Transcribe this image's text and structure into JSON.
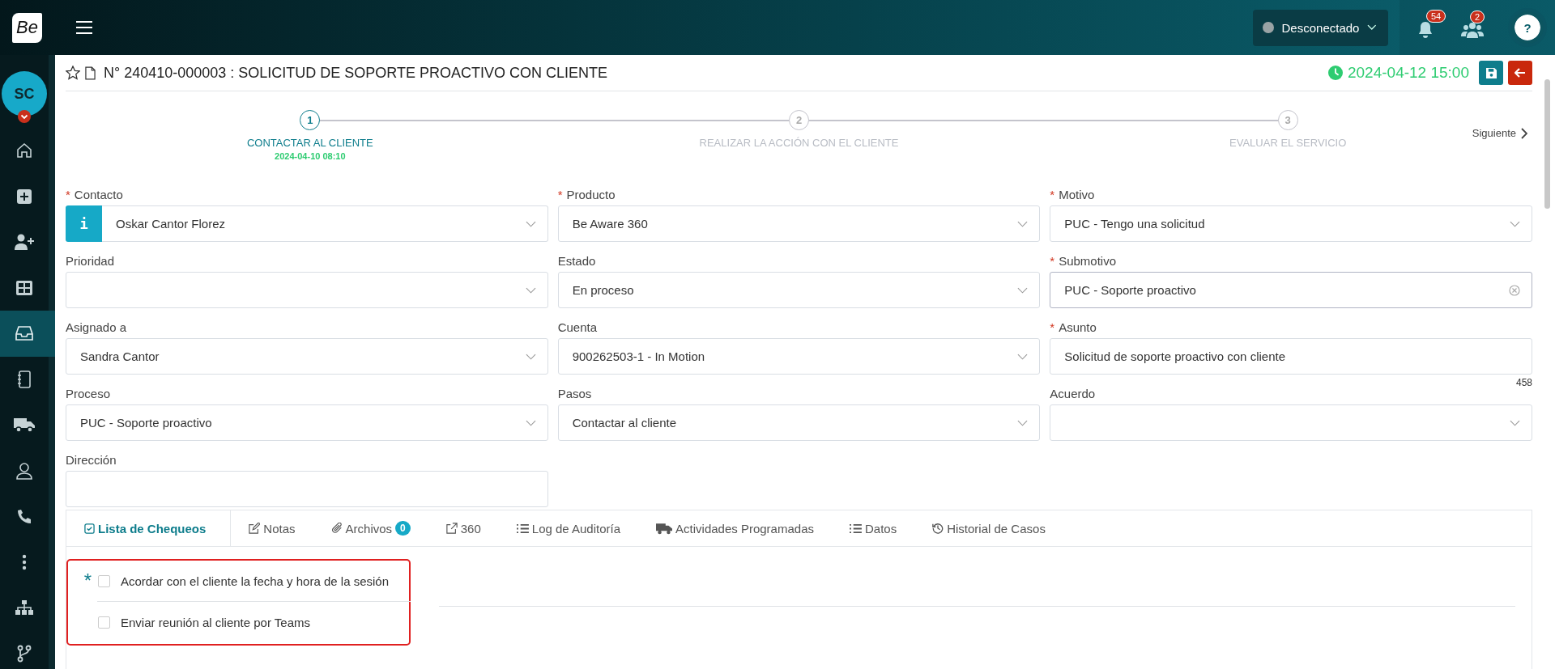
{
  "app": {
    "logo": "Be"
  },
  "top_bar": {
    "status": {
      "label": "Desconectado",
      "online": false
    },
    "notifications": {
      "count": "54"
    },
    "contacts": {
      "count": "2"
    },
    "help": "?"
  },
  "sidebar": {
    "avatar": "SC",
    "items": [
      {
        "selected": false
      },
      {
        "selected": false
      },
      {
        "selected": false
      },
      {
        "selected": false
      },
      {
        "selected": true
      },
      {
        "selected": false
      },
      {
        "selected": false
      },
      {
        "selected": false
      },
      {
        "selected": false
      },
      {
        "selected": false
      },
      {
        "selected": false
      },
      {
        "selected": false
      }
    ]
  },
  "case": {
    "starred": false,
    "title": "N° 240410-000003 : SOLICITUD DE SOPORTE PROACTIVO CON CLIENTE",
    "due": "2024-04-12 15:00"
  },
  "steps": [
    {
      "number": "1",
      "label": "CONTACTAR AL CLIENTE",
      "date": "2024-04-10 08:10",
      "selected": true
    },
    {
      "number": "2",
      "label": "REALIZAR LA ACCIÓN CON EL CLIENTE",
      "selected": false
    },
    {
      "number": "3",
      "label": "EVALUAR EL SERVICIO",
      "selected": false
    }
  ],
  "next": "Siguiente",
  "fields": [
    {
      "label": "Contacto",
      "required_mark": "*",
      "kind": "select",
      "value": "Oskar Cantor Florez",
      "info_button": "i"
    },
    {
      "label": "Producto",
      "required_mark": "*",
      "kind": "select",
      "value": "Be Aware 360"
    },
    {
      "label": "Motivo",
      "required_mark": "*",
      "kind": "select",
      "value": "PUC - Tengo una solicitud"
    },
    {
      "label": "Prioridad",
      "kind": "select"
    },
    {
      "label": "Estado",
      "kind": "select",
      "value": "En proceso"
    },
    {
      "label": "Submotivo",
      "required_mark": "*",
      "kind": "clearable",
      "value": "PUC - Soporte proactivo"
    },
    {
      "label": "Asignado a",
      "kind": "select",
      "value": "Sandra Cantor"
    },
    {
      "label": "Cuenta",
      "kind": "select",
      "value": "900262503-1  - In Motion"
    },
    {
      "label": "Asunto",
      "required_mark": "*",
      "kind": "text",
      "value": "Solicitud de soporte proactivo con cliente",
      "counter": "458"
    },
    {
      "label": "Proceso",
      "kind": "select",
      "value": "PUC - Soporte proactivo"
    },
    {
      "label": "Pasos",
      "kind": "select",
      "value": "Contactar al cliente"
    },
    {
      "label": "Acuerdo",
      "kind": "select"
    },
    {
      "label": "Dirección",
      "kind": "text"
    }
  ],
  "tabs": [
    {
      "label": "Lista de Chequeos",
      "selected": true
    },
    {
      "label": "Notas",
      "selected": false
    },
    {
      "label": "Archivos",
      "badge": "0",
      "selected": false
    },
    {
      "label": "360",
      "selected": false
    },
    {
      "label": "Log de Auditoría",
      "selected": false
    },
    {
      "label": "Actividades Programadas",
      "selected": false
    },
    {
      "label": "Datos",
      "selected": false
    },
    {
      "label": "Historial de Casos",
      "selected": false
    }
  ],
  "checklist": [
    {
      "required_mark": "*",
      "label": "Acordar con el cliente la fecha y hora de la sesión",
      "checked": false
    },
    {
      "label": "Enviar reunión al cliente por Teams",
      "checked": false
    }
  ]
}
